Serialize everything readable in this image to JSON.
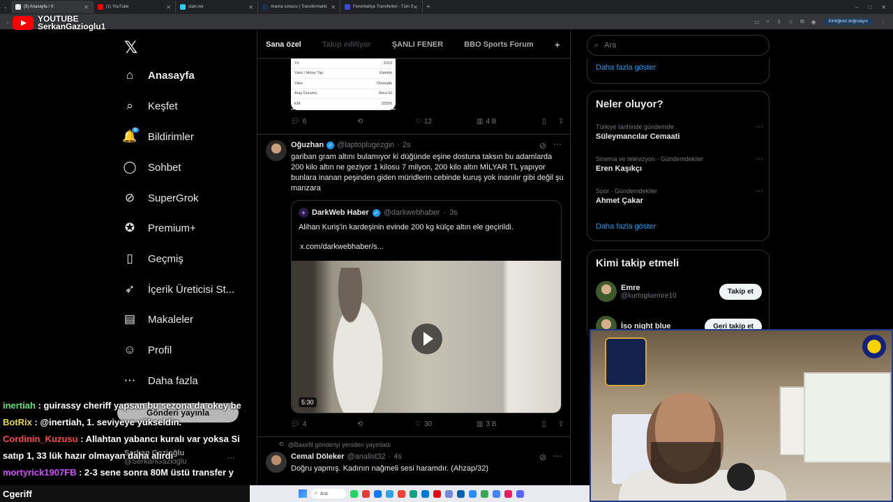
{
  "browser": {
    "tabs": [
      {
        "label": "(9) Anasayfa / X",
        "color": "#e7e9ea"
      },
      {
        "label": "(1) YouTube",
        "color": "#ff0000"
      },
      {
        "label": "start.me",
        "color": "#2ecbf0"
      },
      {
        "label": "Arama sonucu | Transfermarkt",
        "color": "#1a3151"
      },
      {
        "label": "Fenerbahçe Transferleri - Tüm S",
        "color": "#3a4bd8"
      }
    ],
    "verify_label": "Kimliğinizi doğrulayın"
  },
  "stream": {
    "platform": "YOUTUBE",
    "channel": "SerkanGazioglu1"
  },
  "nav": {
    "items": [
      {
        "label": "Anasayfa",
        "icon": "home-icon",
        "glyph": "⌂"
      },
      {
        "label": "Keşfet",
        "icon": "search-icon",
        "glyph": "⌕"
      },
      {
        "label": "Bildirimler",
        "icon": "bell-icon",
        "glyph": "🔔"
      },
      {
        "label": "Sohbet",
        "icon": "chat-icon",
        "glyph": "◯"
      },
      {
        "label": "SuperGrok",
        "icon": "grok-icon",
        "glyph": "⊘"
      },
      {
        "label": "Premium+",
        "icon": "premium-icon",
        "glyph": "✪"
      },
      {
        "label": "Geçmiş",
        "icon": "bookmark-icon",
        "glyph": "▯"
      },
      {
        "label": "İçerik Üreticisi St...",
        "icon": "rocket-icon",
        "glyph": "➶"
      },
      {
        "label": "Makaleler",
        "icon": "article-icon",
        "glyph": "▤"
      },
      {
        "label": "Profil",
        "icon": "profile-icon",
        "glyph": "☺"
      },
      {
        "label": "Daha fazla",
        "icon": "more-circle-icon",
        "glyph": "⋯"
      }
    ],
    "notif_badge": "9",
    "post_label": "Gönderi yayınla",
    "account_name": "Serkan Gazioğlu",
    "account_handle": "@SerkanGazioglu"
  },
  "timeline": {
    "tabs": [
      "Sana özel",
      "Takip ediliyor",
      "ŞANLI FENER",
      "BBO Sports Forum"
    ],
    "car_card": [
      [
        "Yıl",
        "2023"
      ],
      [
        "Yakıt / Motor Tipi",
        "Elektrik"
      ],
      [
        "Vites",
        "Otomatik"
      ],
      [
        "Araç Durumu",
        "İkinci El"
      ],
      [
        "KM",
        "32500"
      ]
    ],
    "post1_actions": {
      "replies": "6",
      "likes": "12",
      "views": "4 B"
    },
    "post2": {
      "name": "Oğuzhan",
      "handle": "@laptoplugezgin",
      "time": "2s",
      "text": "gariban gram altını bulamıyor ki düğünde eşine dostuna taksın bu adamlarda 200 kilo altın ne geziyor 1 kilosu 7 milyon, 200 kilo altın MİLYAR TL yapıyor bunlara inanan peşinden giden müridlerin cebinde kuruş yok inanılır gibi değil şu manzara",
      "quote_name": "DarkWeb Haber",
      "quote_handle": "@darkwebhaber",
      "quote_time": "3s",
      "quote_text": "Alihan Kuriş'in kardeşinin evinde 200 kg külçe altın ele geçirildi.",
      "quote_link": "x.com/darkwebhaber/s...",
      "duration": "5:30",
      "replies": "4",
      "likes": "30",
      "views": "3 B"
    },
    "post3": {
      "repost_note": "@BaxeN gönderiyi yeniden yayınladı",
      "name": "Cemal Döleker",
      "handle": "@analist32",
      "time": "4s",
      "text": "Doğru yapmış. Kadının nağmeli sesi haramdır. (Ahzap/32)"
    }
  },
  "sidebar": {
    "search_placeholder": "Ara",
    "show_more": "Daha fazla göster",
    "trends_title": "Neler oluyor?",
    "trends": [
      {
        "meta": "Türkiye tarihinde gündemde",
        "title": "Süleymancılar Cemaati"
      },
      {
        "meta": "Sinema ve televizyon · Gündemdekiler",
        "title": "Eren Kaşıkçı"
      },
      {
        "meta": "Spor · Gündemdekiler",
        "title": "Ahmet Çakar"
      }
    ],
    "who_title": "Kimi takip etmeli",
    "who": [
      {
        "name": "Emre",
        "handle": "@kurtogluemre10",
        "button": "Takip et"
      },
      {
        "name": "İso night blue",
        "handle": "",
        "button": "Geri takip et"
      }
    ]
  },
  "chat": {
    "lines": [
      {
        "user": "inertiah",
        "color": "#63e07a",
        "msg": " : guirassy cheriff yapsan bu sezona da okey be"
      },
      {
        "user": "BotRix",
        "color": "#e4d84a",
        "msg": " : @inertiah, 1. seviyeye yükseldin."
      },
      {
        "user": "Cordinin_Kuzusu",
        "color": "#ff4a4a",
        "msg": " : Allahtan yabancı kuralı var yoksa Si"
      },
      {
        "user": "",
        "color": "#ffffff",
        "msg": "satıp 1, 33 lük hazır olmayan daha alırdı"
      },
      {
        "user": "mortyrick1907FB",
        "color": "#d04dff",
        "msg": " : 2-3 sene sonra 80M üstü transfer y"
      }
    ],
    "input_user": "Cgeriff"
  },
  "taskbar": {
    "search": "Ara",
    "icon_colors": [
      "#25d366",
      "#e53935",
      "#1877f2",
      "#2ca5e0",
      "#ea4335",
      "#10a37f",
      "#0078d4",
      "#e50914",
      "#7289da",
      "#0063b1",
      "#2d8cff",
      "#34a853",
      "#4285f4",
      "#e91e63",
      "#5865f2"
    ]
  }
}
